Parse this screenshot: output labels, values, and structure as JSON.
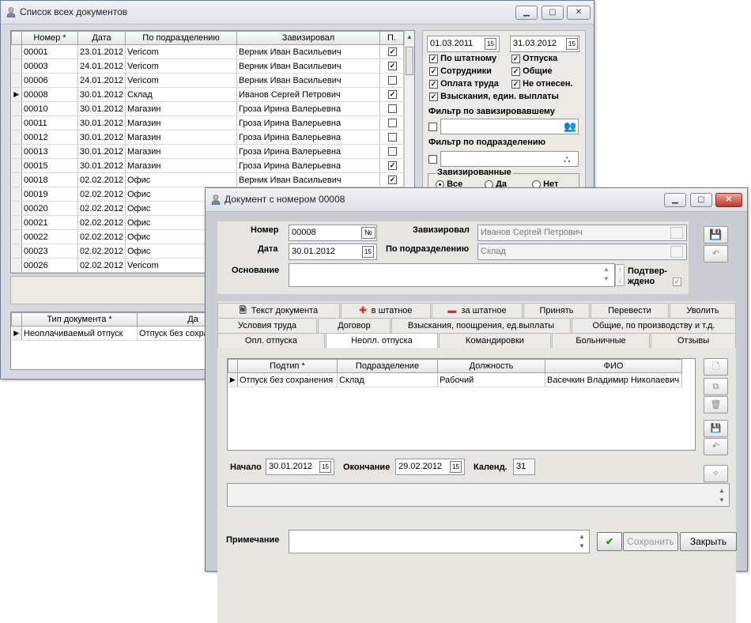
{
  "list_window": {
    "title": "Список всех документов",
    "columns": [
      "Номер *",
      "Дата",
      "По подразделению",
      "Завизировал",
      "П."
    ],
    "rows": [
      {
        "num": "00001",
        "date": "23.01.2012",
        "dept": "Vericom",
        "signed": "Верник Иван Васильевич",
        "p": true,
        "cur": false
      },
      {
        "num": "00003",
        "date": "24.01.2012",
        "dept": "Vericom",
        "signed": "Верник Иван Васильевич",
        "p": true,
        "cur": false
      },
      {
        "num": "00006",
        "date": "24.01.2012",
        "dept": "Vericom",
        "signed": "Верник Иван Васильевич",
        "p": false,
        "cur": false
      },
      {
        "num": "00008",
        "date": "30.01.2012",
        "dept": "Склад",
        "signed": "Иванов Сергей  Петрович",
        "p": true,
        "cur": true
      },
      {
        "num": "00010",
        "date": "30.01.2012",
        "dept": "Магазин",
        "signed": "Гроза Ирина Валерьевна",
        "p": false,
        "cur": false
      },
      {
        "num": "00011",
        "date": "30.01.2012",
        "dept": "Магазин",
        "signed": "Гроза Ирина Валерьевна",
        "p": false,
        "cur": false
      },
      {
        "num": "00012",
        "date": "30.01.2012",
        "dept": "Магазин",
        "signed": "Гроза Ирина Валерьевна",
        "p": false,
        "cur": false
      },
      {
        "num": "00013",
        "date": "30.01.2012",
        "dept": "Магазин",
        "signed": "Гроза Ирина Валерьевна",
        "p": false,
        "cur": false
      },
      {
        "num": "00015",
        "date": "30.01.2012",
        "dept": "Магазин",
        "signed": "Гроза Ирина Валерьевна",
        "p": true,
        "cur": false
      },
      {
        "num": "00018",
        "date": "02.02.2012",
        "dept": "Офис",
        "signed": "Верник Иван Васильевич",
        "p": true,
        "cur": false
      },
      {
        "num": "00019",
        "date": "02.02.2012",
        "dept": "Офис",
        "signed": "",
        "p": false,
        "cur": false
      },
      {
        "num": "00020",
        "date": "02.02.2012",
        "dept": "Офис",
        "signed": "",
        "p": false,
        "cur": false
      },
      {
        "num": "00021",
        "date": "02.02.2012",
        "dept": "Офис",
        "signed": "",
        "p": false,
        "cur": false
      },
      {
        "num": "00022",
        "date": "02.02.2012",
        "dept": "Офис",
        "signed": "",
        "p": false,
        "cur": false
      },
      {
        "num": "00023",
        "date": "02.02.2012",
        "dept": "Офис",
        "signed": "",
        "p": false,
        "cur": false
      },
      {
        "num": "00026",
        "date": "02.02.2012",
        "dept": "Vericom",
        "signed": "",
        "p": false,
        "cur": false
      }
    ],
    "date_from": "01.03.2011",
    "date_to": "31.03.2012",
    "filters": [
      {
        "label": "По штатному",
        "checked": true
      },
      {
        "label": "Отпуска",
        "checked": true
      },
      {
        "label": "Сотрудники",
        "checked": true
      },
      {
        "label": "Общие",
        "checked": true
      },
      {
        "label": "Оплата труда",
        "checked": true
      },
      {
        "label": "Не отнесен.",
        "checked": true
      },
      {
        "label": "Взыскания, един. выплаты",
        "checked": true
      }
    ],
    "filter_signed_label": "Фильтр по завизировавшему",
    "filter_dept_label": "Фильтр по подразделению",
    "signed_group_label": "Завизированные",
    "radios": [
      "Все",
      "Да",
      "Нет"
    ],
    "radio_selected": "Все",
    "sub_columns": [
      "Тип документа *",
      "Да"
    ],
    "sub_row": {
      "type": "Неоплачиваемый отпуск",
      "val": "Отпуск без сохра"
    }
  },
  "doc_window": {
    "title": "Документ с номером 00008",
    "number_label": "Номер",
    "number": "00008",
    "date_label": "Дата",
    "date": "30.01.2012",
    "signed_label": "Завизировал",
    "signed": "Иванов Сергей  Петрович",
    "dept_label": "По подразделению",
    "dept": "Склад",
    "basis_label": "Основание",
    "basis": "",
    "confirmed_label_1": "Подтвер-",
    "confirmed_label_2": "ждено",
    "tabs_row1": [
      "Текст документа",
      "в штатное",
      "за штатное",
      "Принять",
      "Перевести",
      "Уволить"
    ],
    "tabs_row2": [
      "Условия труда",
      "Договор",
      "Взыскания, поощрения, ед.выплаты",
      "Общие, по производству и т.д."
    ],
    "tabs_row3": [
      "Опл. отпуска",
      "Неопл. отпуска",
      "Командировки",
      "Больничные",
      "Отзывы"
    ],
    "active_tab": "Неопл. отпуска",
    "grid_columns": [
      "Подтип *",
      "Подразделение",
      "Должность",
      "ФИО"
    ],
    "grid_row": {
      "subtype": "Отпуск без сохранения",
      "dept": "Склад",
      "pos": "Рабочий",
      "fio": "Васечкин Владимир Николаевич"
    },
    "start_label": "Начало",
    "start": "30.01.2012",
    "end_label": "Окончание",
    "end": "29.02.2012",
    "cal_label": "Календ.",
    "cal": "31",
    "note_label": "Примечание",
    "note": "",
    "save_label": "Сохранить",
    "close_label": "Закрыть"
  }
}
